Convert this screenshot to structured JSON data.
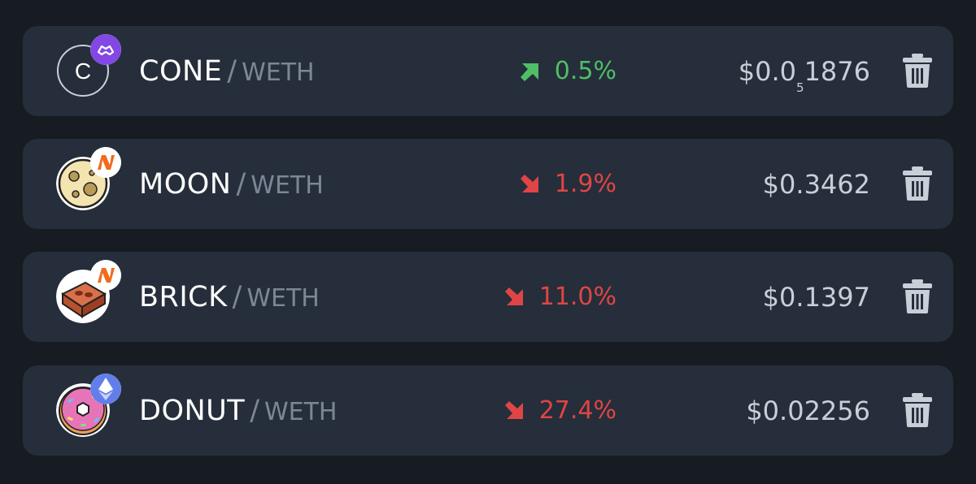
{
  "watchlist": [
    {
      "symbol": "CONE",
      "quote": "WETH",
      "change": "0.5%",
      "direction": "up",
      "price_prefix": "$0.0",
      "price_subscript": "5",
      "price_suffix": "1876",
      "token_icon": "cone-token-icon",
      "chain_icon": "polygon-icon"
    },
    {
      "symbol": "MOON",
      "quote": "WETH",
      "change": "1.9%",
      "direction": "down",
      "price_prefix": "$0.3462",
      "price_subscript": "",
      "price_suffix": "",
      "token_icon": "moon-token-icon",
      "chain_icon": "arbitrum-nova-icon"
    },
    {
      "symbol": "BRICK",
      "quote": "WETH",
      "change": "11.0%",
      "direction": "down",
      "price_prefix": "$0.1397",
      "price_subscript": "",
      "price_suffix": "",
      "token_icon": "brick-token-icon",
      "chain_icon": "arbitrum-nova-icon"
    },
    {
      "symbol": "DONUT",
      "quote": "WETH",
      "change": "27.4%",
      "direction": "down",
      "price_prefix": "$0.02256",
      "price_subscript": "",
      "price_suffix": "",
      "token_icon": "donut-token-icon",
      "chain_icon": "ethereum-icon"
    }
  ],
  "separator": "/",
  "cone_letter": "C",
  "colors": {
    "up": "#4fbf67",
    "down": "#e04545",
    "card": "#252e3a",
    "background": "#161c22"
  }
}
